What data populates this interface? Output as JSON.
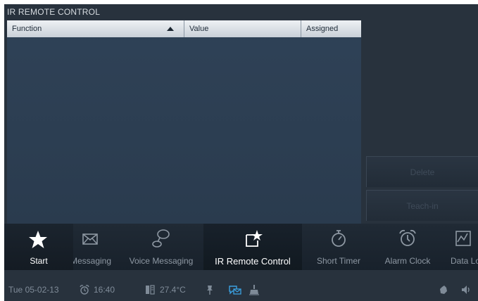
{
  "header": {
    "title": "IR REMOTE CONTROL"
  },
  "table": {
    "columns": [
      "Function",
      "Value",
      "Assigned"
    ],
    "sort": "ascending",
    "rows": []
  },
  "side_buttons": {
    "delete_label": "Delete",
    "teach_label": "Teach-in"
  },
  "start": {
    "label": "Start"
  },
  "apps": [
    {
      "label": "Messaging",
      "icon": "envelope-icon"
    },
    {
      "label": "Voice Messaging",
      "icon": "voice-message-icon"
    },
    {
      "label": "IR Remote Control",
      "icon": "ir-remote-icon",
      "active": true
    },
    {
      "label": "Short Timer",
      "icon": "stopwatch-icon"
    },
    {
      "label": "Alarm Clock",
      "icon": "alarm-clock-icon"
    },
    {
      "label": "Data Logger",
      "icon": "data-logger-icon"
    }
  ],
  "status": {
    "date": "Tue 05-02-13",
    "time": "16:40",
    "temperature": "27.4°C"
  },
  "colors": {
    "background": "#28323d",
    "table_body": "#2d3f53",
    "accent_active_icon": "#3aa0e0"
  }
}
